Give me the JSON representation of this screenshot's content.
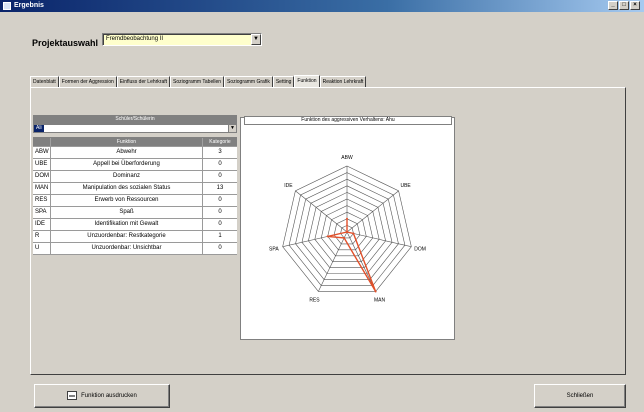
{
  "window": {
    "title": "Ergebnis",
    "controls": [
      "_",
      "□",
      "×"
    ]
  },
  "project": {
    "label": "Projektauswahl",
    "selected": "Fremdbeobachtung II"
  },
  "tabs": [
    {
      "label": "Datenblatt"
    },
    {
      "label": "Formen der Aggression"
    },
    {
      "label": "Einfluss der Lehrkraft"
    },
    {
      "label": "Soziogramm Tabellen"
    },
    {
      "label": "Soziogramm Grafik"
    },
    {
      "label": "Setting"
    },
    {
      "label": "Funktion"
    },
    {
      "label": "Reaktion Lehrkraft"
    }
  ],
  "active_tab": 6,
  "left": {
    "header": "Schüler/Schülerin",
    "selected_student": "Ali",
    "columns": [
      "",
      "Funktion",
      "Kategorie"
    ],
    "rows": [
      {
        "code": "ABW",
        "name": "Abwehr",
        "value": "3"
      },
      {
        "code": "UBE",
        "name": "Appell bei Überforderung",
        "value": "0"
      },
      {
        "code": "DOM",
        "name": "Dominanz",
        "value": "0"
      },
      {
        "code": "MAN",
        "name": "Manipulation des sozialen Status",
        "value": "13"
      },
      {
        "code": "RES",
        "name": "Erwerb von Ressourcen",
        "value": "0"
      },
      {
        "code": "SPA",
        "name": "Spaß",
        "value": "0"
      },
      {
        "code": "IDE",
        "name": "Identifikation mit Gewalt",
        "value": "0"
      },
      {
        "code": "R",
        "name": "Unzuordenbar: Restkategorie",
        "value": "1"
      },
      {
        "code": "U",
        "name": "Unzuordenbar: Unsichtbar",
        "value": "0"
      }
    ]
  },
  "chart_data": {
    "type": "radar",
    "title": "Funktion des aggressiven Verhaltens: Ahu",
    "axes": [
      "ABW",
      "UBE",
      "DOM",
      "MAN",
      "RES",
      "SPA",
      "IDE"
    ],
    "rings": 10,
    "series": [
      {
        "values": [
          2,
          0,
          1,
          10,
          1,
          3,
          0
        ]
      }
    ],
    "series_color": "#e2502a"
  },
  "buttons": {
    "print": "Funktion ausdrucken",
    "close": "Schließen"
  }
}
